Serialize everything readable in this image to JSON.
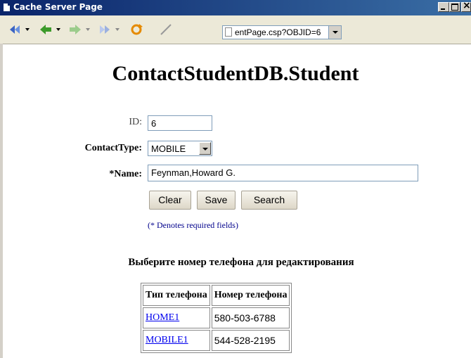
{
  "window": {
    "title": "Cache Server Page"
  },
  "toolbar": {
    "address": "entPage.csp?OBJID=6"
  },
  "page": {
    "title": "ContactStudentDB.Student"
  },
  "form": {
    "id_label": "ID:",
    "id_value": "6",
    "contacttype_label": "ContactType:",
    "contacttype_value": "MOBILE",
    "name_label": "*Name:",
    "name_value": "Feynman,Howard G.",
    "clear_label": "Clear",
    "save_label": "Save",
    "search_label": "Search",
    "note": "(* Denotes required fields)"
  },
  "phones": {
    "heading": "Выберите номер телефона для редактирования",
    "columns": [
      "Тип телефона",
      "Номер телефона"
    ],
    "rows": [
      {
        "type": "HOME1",
        "number": "580-503-6788"
      },
      {
        "type": "MOBILE1",
        "number": "544-528-2195"
      }
    ]
  },
  "colors": {
    "titlebar": "#0a246a",
    "link": "#0000ee",
    "note": "#00008b"
  }
}
